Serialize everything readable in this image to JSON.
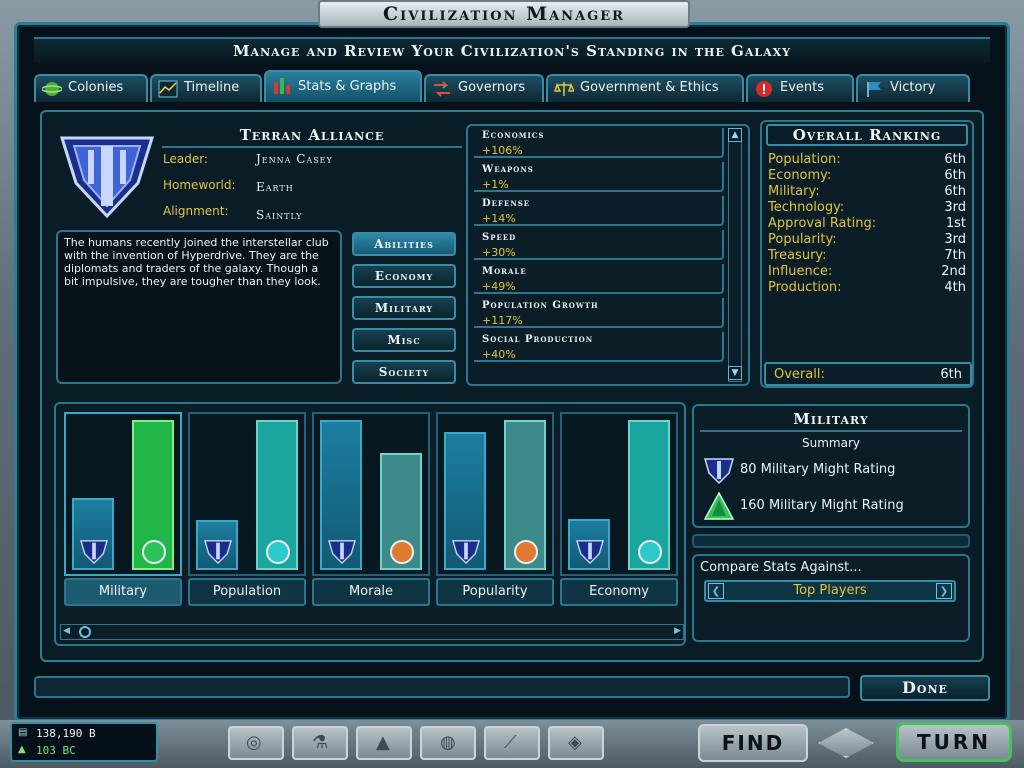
{
  "window": {
    "title": "Civilization Manager",
    "subtitle": "Manage and Review Your Civilization's Standing in the Galaxy"
  },
  "tabs": [
    {
      "label": "Colonies",
      "icon": "planet-icon"
    },
    {
      "label": "Timeline",
      "icon": "line-graph-icon"
    },
    {
      "label": "Stats & Graphs",
      "icon": "bar-chart-icon",
      "active": true
    },
    {
      "label": "Governors",
      "icon": "swap-arrows-icon"
    },
    {
      "label": "Government & Ethics",
      "icon": "scales-icon"
    },
    {
      "label": "Events",
      "icon": "alert-icon"
    },
    {
      "label": "Victory",
      "icon": "flag-icon"
    }
  ],
  "civ": {
    "name": "Terran Alliance",
    "leader_label": "Leader:",
    "leader": "Jenna Casey",
    "homeworld_label": "Homeworld:",
    "homeworld": "Earth",
    "alignment_label": "Alignment:",
    "alignment": "Saintly",
    "description": "The humans recently joined the interstellar club with the invention of Hyperdrive. They are the diplomats and traders of the galaxy. Though a bit impulsive, they are tougher than they look."
  },
  "categories": [
    {
      "label": "Abilities",
      "active": true
    },
    {
      "label": "Economy"
    },
    {
      "label": "Military"
    },
    {
      "label": "Misc"
    },
    {
      "label": "Society"
    }
  ],
  "abilities": [
    {
      "name": "Economics",
      "value": "+106%"
    },
    {
      "name": "Weapons",
      "value": "+1%"
    },
    {
      "name": "Defense",
      "value": "+14%"
    },
    {
      "name": "Speed",
      "value": "+30%"
    },
    {
      "name": "Morale",
      "value": "+49%"
    },
    {
      "name": "Population Growth",
      "value": "+117%"
    },
    {
      "name": "Social Production",
      "value": "+40%"
    }
  ],
  "ranking": {
    "title": "Overall Ranking",
    "rows": [
      {
        "label": "Population:",
        "value": "6th"
      },
      {
        "label": "Economy:",
        "value": "6th"
      },
      {
        "label": "Military:",
        "value": "6th"
      },
      {
        "label": "Technology:",
        "value": "3rd"
      },
      {
        "label": "Approval Rating:",
        "value": "1st"
      },
      {
        "label": "Popularity:",
        "value": "3rd"
      },
      {
        "label": "Treasury:",
        "value": "7th"
      },
      {
        "label": "Influence:",
        "value": "2nd"
      },
      {
        "label": "Production:",
        "value": "4th"
      }
    ],
    "overall_label": "Overall:",
    "overall_value": "6th"
  },
  "bars": [
    {
      "label": "Military",
      "selected": true,
      "player": 0.48,
      "rival": 1.0,
      "rival_icon": "green-alien-emblem-icon",
      "rival_color": "#22b548"
    },
    {
      "label": "Population",
      "player": 0.33,
      "rival": 1.0,
      "rival_icon": "teal-alien-emblem-icon",
      "rival_color": "#1aa59e"
    },
    {
      "label": "Morale",
      "player": 1.0,
      "rival": 0.78,
      "rival_icon": "orange-alien-emblem-icon",
      "rival_color": "#3e8a8a"
    },
    {
      "label": "Popularity",
      "player": 0.92,
      "rival": 1.0,
      "rival_icon": "orange-alien-emblem-icon",
      "rival_color": "#3e8a8a"
    },
    {
      "label": "Economy",
      "player": 0.34,
      "rival": 1.0,
      "rival_icon": "teal-alien-emblem-icon",
      "rival_color": "#1aa59e"
    }
  ],
  "summary": {
    "title": "Military",
    "subtitle": "Summary",
    "player_text": "80 Military Might Rating",
    "rival_text": "160 Military Might Rating"
  },
  "compare": {
    "label": "Compare Stats Against...",
    "value": "Top Players"
  },
  "done_label": "Done",
  "status": {
    "money": "138,190 B",
    "year": "103 BC"
  },
  "bottom": {
    "find_label": "FIND",
    "turn_label": "TURN"
  },
  "colors": {
    "accent": "#2d7d95",
    "gold": "#e2c341",
    "player_bar": "#1a6f8f",
    "active_tab": "#2a7f9e"
  }
}
